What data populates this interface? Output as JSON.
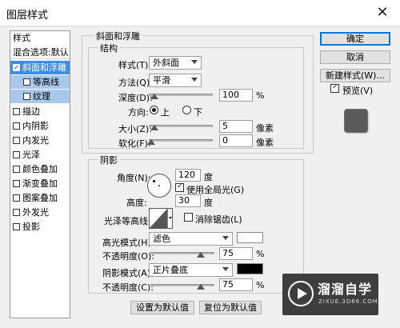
{
  "window": {
    "title": "图层样式",
    "close_icon": "close-icon"
  },
  "left_panel": {
    "header": "样式",
    "items": [
      {
        "label": "混合选项:默认",
        "checkbox": false,
        "checked": false,
        "selected": false,
        "sub": false
      },
      {
        "label": "斜面和浮雕",
        "checkbox": true,
        "checked": true,
        "selected": true,
        "sub": false
      },
      {
        "label": "等高线",
        "checkbox": true,
        "checked": false,
        "selected": false,
        "sub": true
      },
      {
        "label": "纹理",
        "checkbox": true,
        "checked": false,
        "selected": false,
        "sub": true
      },
      {
        "label": "描边",
        "checkbox": true,
        "checked": false,
        "selected": false,
        "sub": false
      },
      {
        "label": "内阴影",
        "checkbox": true,
        "checked": false,
        "selected": false,
        "sub": false
      },
      {
        "label": "内发光",
        "checkbox": true,
        "checked": false,
        "selected": false,
        "sub": false
      },
      {
        "label": "光泽",
        "checkbox": true,
        "checked": false,
        "selected": false,
        "sub": false
      },
      {
        "label": "颜色叠加",
        "checkbox": true,
        "checked": false,
        "selected": false,
        "sub": false
      },
      {
        "label": "渐变叠加",
        "checkbox": true,
        "checked": false,
        "selected": false,
        "sub": false
      },
      {
        "label": "图案叠加",
        "checkbox": true,
        "checked": false,
        "selected": false,
        "sub": false
      },
      {
        "label": "外发光",
        "checkbox": true,
        "checked": false,
        "selected": false,
        "sub": false
      },
      {
        "label": "投影",
        "checkbox": true,
        "checked": false,
        "selected": false,
        "sub": false
      }
    ]
  },
  "bevel": {
    "group_title": "斜面和浮雕",
    "structure_title": "结构",
    "style_label": "样式(T):",
    "style_value": "外斜面",
    "method_label": "方法(Q):",
    "method_value": "平滑",
    "depth_label": "深度(D):",
    "depth_value": "100",
    "depth_unit": "%",
    "direction_label": "方向:",
    "direction_up": "上",
    "direction_down": "下",
    "size_label": "大小(Z):",
    "size_value": "5",
    "size_unit": "像素",
    "soften_label": "软化(F):",
    "soften_value": "0",
    "soften_unit": "像素"
  },
  "shading": {
    "title": "阴影",
    "angle_label": "角度(N):",
    "angle_value": "120",
    "angle_unit": "度",
    "global_light_label": "使用全局光(G)",
    "global_light_checked": true,
    "altitude_label": "高度:",
    "altitude_value": "30",
    "altitude_unit": "度",
    "gloss_label": "光泽等高线:",
    "anti_alias_label": "消除锯齿(L)",
    "highlight_mode_label": "高光模式(H):",
    "highlight_mode_value": "滤色",
    "highlight_color": "#ffffff",
    "highlight_opacity_label": "不透明度(O):",
    "highlight_opacity_value": "75",
    "opacity_unit": "%",
    "shadow_mode_label": "阴影模式(A):",
    "shadow_mode_value": "正片叠底",
    "shadow_color": "#000000",
    "shadow_opacity_label": "不透明度(C):",
    "shadow_opacity_value": "75"
  },
  "buttons": {
    "ok": "确定",
    "cancel": "取消",
    "new_style": "新建样式(W)...",
    "preview_label": "预览(V)",
    "preview_checked": true,
    "set_default": "设置为默认值",
    "reset_default": "复位为默认值"
  },
  "watermark": {
    "brand": "溜溜自学",
    "url": "ZIXUE.3D66.COM"
  }
}
